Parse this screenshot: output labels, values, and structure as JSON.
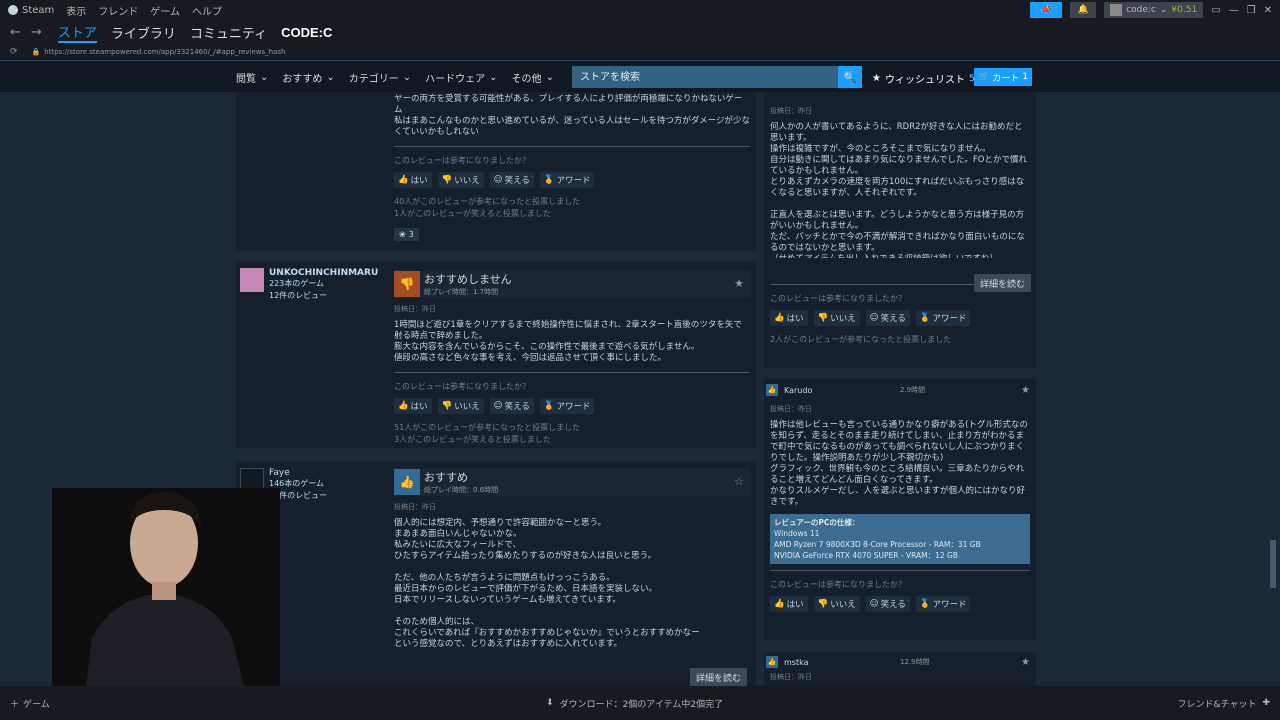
{
  "top_menu": {
    "app": "Steam",
    "items": [
      "表示",
      "フレンド",
      "ゲーム",
      "ヘルプ"
    ]
  },
  "account": {
    "name": "code:c",
    "balance": "¥0.51"
  },
  "nav_tabs": [
    "ストア",
    "ライブラリ",
    "コミュニティ",
    "CODE:C"
  ],
  "url": "https://store.steampowered.com/app/3321460/_/#app_reviews_hash",
  "store_nav": {
    "items": [
      "閲覧",
      "おすすめ",
      "カテゴリー",
      "ハードウェア",
      "その他"
    ],
    "search_placeholder": "ストアを検索",
    "wishlist_label": "ウィッシュリスト",
    "wishlist_count": "5",
    "cart_label": "カート",
    "cart_count": "1"
  },
  "common": {
    "helpful_question": "このレビューは参考になりましたか？",
    "yes": "はい",
    "no": "いいえ",
    "funny": "笑える",
    "award": "アワード",
    "read_more": "詳細を読む",
    "posted": "投稿日：昨日"
  },
  "left_reviews": [
    {
      "text": "ヤーの両方を受賞する可能性がある、プレイする人により評価が両極端になりかねないゲーム\n私はまあこんなものかと思い進めているが、迷っている人はセールを待つ方がダメージが少なくていいかもしれない",
      "stat1": "40人がこのレビューが参考になったと投票しました",
      "stat2": "1人がこのレビューが笑えると投票しました",
      "award_count": "3"
    },
    {
      "name": "UNKOCHINCHINMARU",
      "games": "223本のゲーム",
      "reviews": "12件のレビュー",
      "verdict": "おすすめしません",
      "hours": "総プレイ時間：1.7時間",
      "text": "1時間ほど遊び1章をクリアするまで終始操作性に悩まされ、2章スタート直後のツタを矢で射る時点で辞めました。\n膨大な内容を含んでいるからこそ、この操作性で最後まで遊べる気がしません。\n値段の高さなど色々な事を考え、今回は返品させて頂く事にしました。",
      "stat1": "51人がこのレビューが参考になったと投票しました",
      "stat2": "3人がこのレビューが笑えると投票しました"
    },
    {
      "name": "Faye",
      "games": "146本のゲーム",
      "reviews": "61件のレビュー",
      "verdict": "おすすめ",
      "hours": "総プレイ時間：0.6時間",
      "text": "個人的には想定内、予想通りで許容範囲かなーと思う。\nまあまあ面白いんじゃないかな。\n私みたいに広大なフィールドで、\nひたすらアイテム拾ったり集めたりするのが好きな人は良いと思う。\n\nただ、他の人たちが言うように問題点もけっっこうある。\n最近日本からのレビューで評価が下がるため、日本語を実装しない。\n日本でリリースしないっていうゲームも増えてきています。\n\nそのため個人的には、\nこれくらいであれば『おすすめかおすすめじゃないか』でいうとおすすめかなー\nという感覚なので、とりあえずはおすすめに入れています。"
    }
  ],
  "right_reviews": [
    {
      "text": "何人かの人が書いてあるように、RDR2が好きな人にはお勧めだと思います。\n操作は複雑ですが、今のところそこまで気になりません。\n自分は動きに関してはあまり気になりませんでした。FOとかで慣れているかもしれません。\nとりあえずカメラの速度を両方100にすればだいぶもっさり感はなくなると思いますが、人それぞれです。\n\n正直人を選ぶとは思います。どうしようかなと思う方は様子見の方がいいかもしれません。\nただ、パッチとかで今の不満が解消できればかなり面白いものになるのではないかと思います。\n（せめてアイテムを出し入れできる収納箱は欲しいですね）",
      "stat1": "2人がこのレビューが参考になったと投票しました"
    },
    {
      "name": "Karudo",
      "hours": "2.9時間",
      "text": "操作は他レビューも言っている通りかなり癖がある(トグル形式なのを知らず、走るとそのまま走り続けてしまい、止まり方がわかるまで町中で気になるものがあっても調べられないし人にぶつかりまくりでした。操作説明あたりが少し不親切かも)\nグラフィック、世界観も今のところ結構良い。三章あたりからやれること増えてどんどん面白くなってきます。\nかなりスルメゲーだし、人を選ぶと思いますが個人的にはかなり好きです。",
      "spec_title": "レビュアーのPCの仕様：",
      "spec_lines": [
        "Windows 11",
        "AMD Ryzen 7 9800X3D 8-Core Processor - RAM：31 GB",
        "NVIDIA GeForce RTX 4070 SUPER - VRAM：12 GB"
      ]
    },
    {
      "name": "mstka",
      "hours": "12.9時間"
    }
  ],
  "bottom_bar": {
    "left": "ゲーム",
    "downloads": "ダウンロード：2個のアイテム中2個完了",
    "right": "フレンド&チャット"
  }
}
